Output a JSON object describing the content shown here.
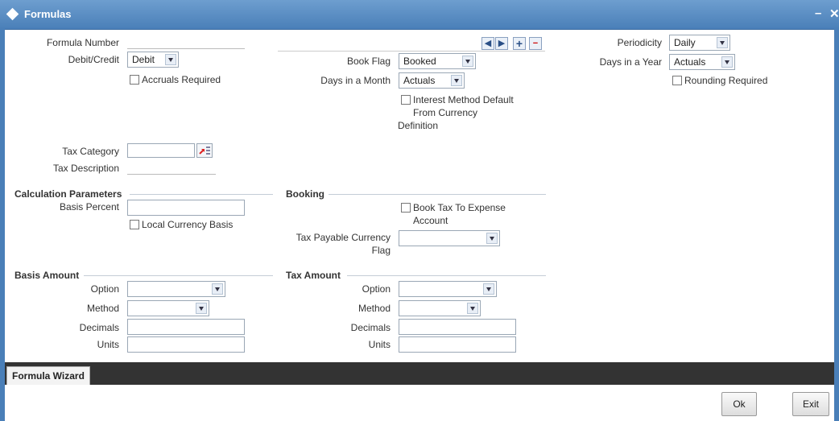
{
  "window": {
    "title": "Formulas",
    "minimize": "–",
    "close": "✕"
  },
  "header": {
    "formula_number_label": "Formula Number",
    "debit_credit_label": "Debit/Credit",
    "debit_credit_value": "Debit",
    "accruals_required_label": "Accruals Required",
    "book_flag_label": "Book Flag",
    "book_flag_value": "Booked",
    "days_in_month_label": "Days in a Month",
    "days_in_month_value": "Actuals",
    "interest_method_label_1": "Interest Method Default",
    "interest_method_label_2": "From Currency",
    "interest_method_label_3": "Definition",
    "periodicity_label": "Periodicity",
    "periodicity_value": "Daily",
    "days_in_year_label": "Days in a Year",
    "days_in_year_value": "Actuals",
    "rounding_required_label": "Rounding Required",
    "tax_category_label": "Tax Category",
    "tax_description_label": "Tax Description"
  },
  "calc": {
    "title": "Calculation Parameters",
    "basis_percent_label": "Basis Percent",
    "local_currency_basis_label": "Local Currency Basis"
  },
  "booking": {
    "title": "Booking",
    "book_tax_label_1": "Book Tax To Expense",
    "book_tax_label_2": "Account",
    "tax_payable_label_1": "Tax Payable Currency",
    "tax_payable_label_2": "Flag"
  },
  "basis_amount": {
    "title": "Basis Amount",
    "option_label": "Option",
    "method_label": "Method",
    "decimals_label": "Decimals",
    "units_label": "Units"
  },
  "tax_amount": {
    "title": "Tax Amount",
    "option_label": "Option",
    "method_label": "Method",
    "decimals_label": "Decimals",
    "units_label": "Units"
  },
  "tabs": {
    "formula_wizard": "Formula Wizard"
  },
  "footer": {
    "ok": "Ok",
    "exit": "Exit"
  }
}
